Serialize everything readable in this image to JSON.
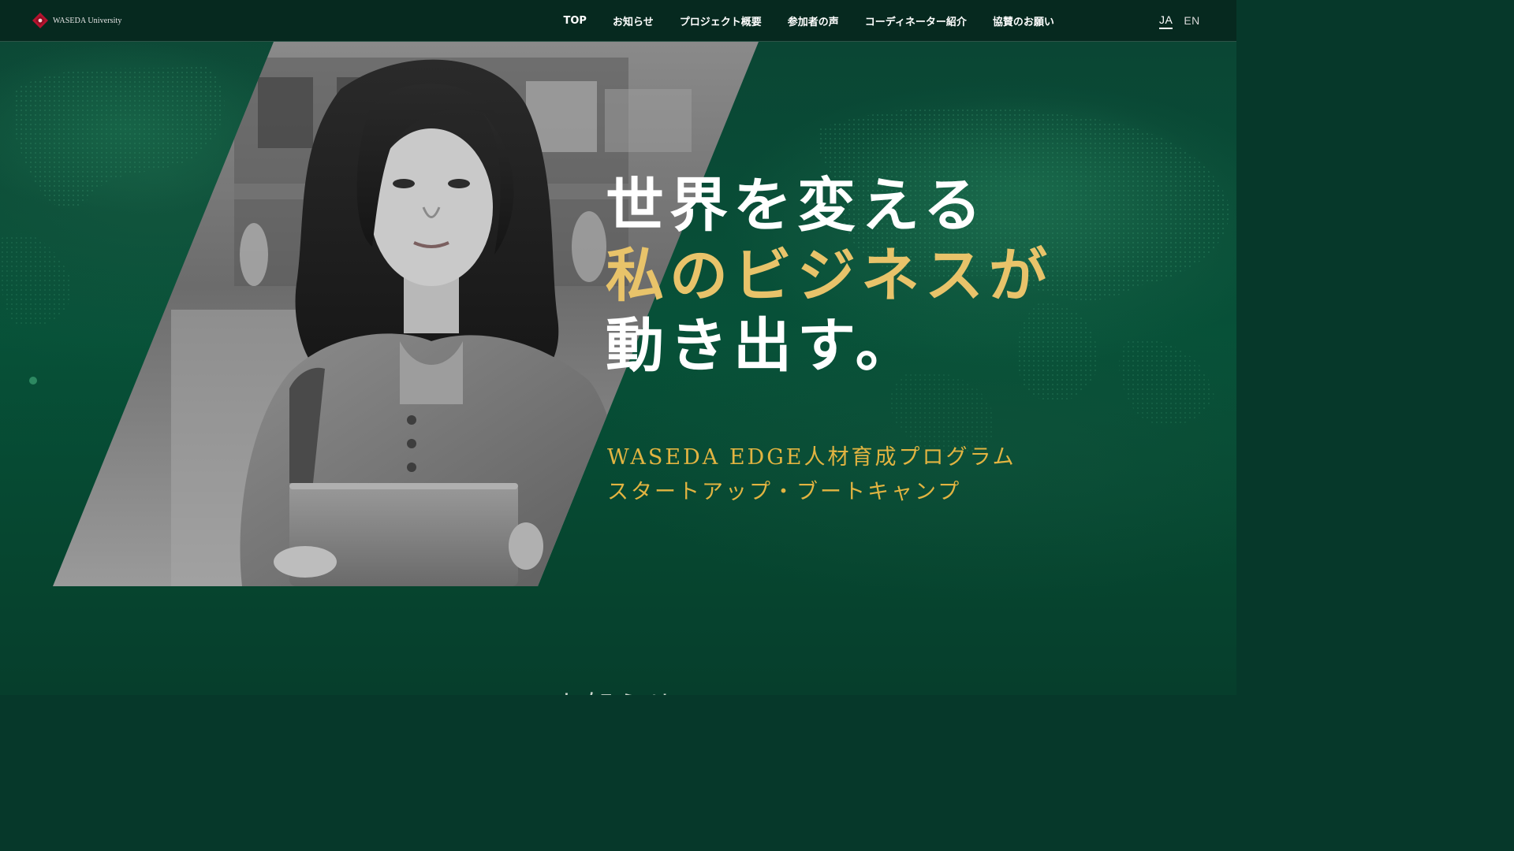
{
  "logo": {
    "text": "WASEDA University",
    "icon": "waseda-emblem-icon",
    "emblem_color": "#b5122e"
  },
  "nav": {
    "items": [
      {
        "label": "TOP"
      },
      {
        "label": "お知らせ"
      },
      {
        "label": "プロジェクト概要"
      },
      {
        "label": "参加者の声"
      },
      {
        "label": "コーディネーター紹介"
      },
      {
        "label": "協賛のお願い"
      }
    ]
  },
  "lang": {
    "items": [
      {
        "label": "JA",
        "active": true
      },
      {
        "label": "EN",
        "active": false
      }
    ]
  },
  "hero": {
    "headline": {
      "line1": "世界を変える",
      "line2": "私のビジネスが",
      "line3": "動き出す。"
    },
    "subtitle": {
      "line1": "WASEDA EDGE人材育成プログラム",
      "line2": "スタートアップ・ブートキャンプ"
    },
    "photo": "student-holding-laptop-photo"
  },
  "section_peek": {
    "title": "お知らせ"
  },
  "colors": {
    "header_bg": "#06291f",
    "hero_green": "#075138",
    "headline_white": "#ffffff",
    "headline_gold": "#e8c36a",
    "subtitle_gold": "#e2b441"
  }
}
